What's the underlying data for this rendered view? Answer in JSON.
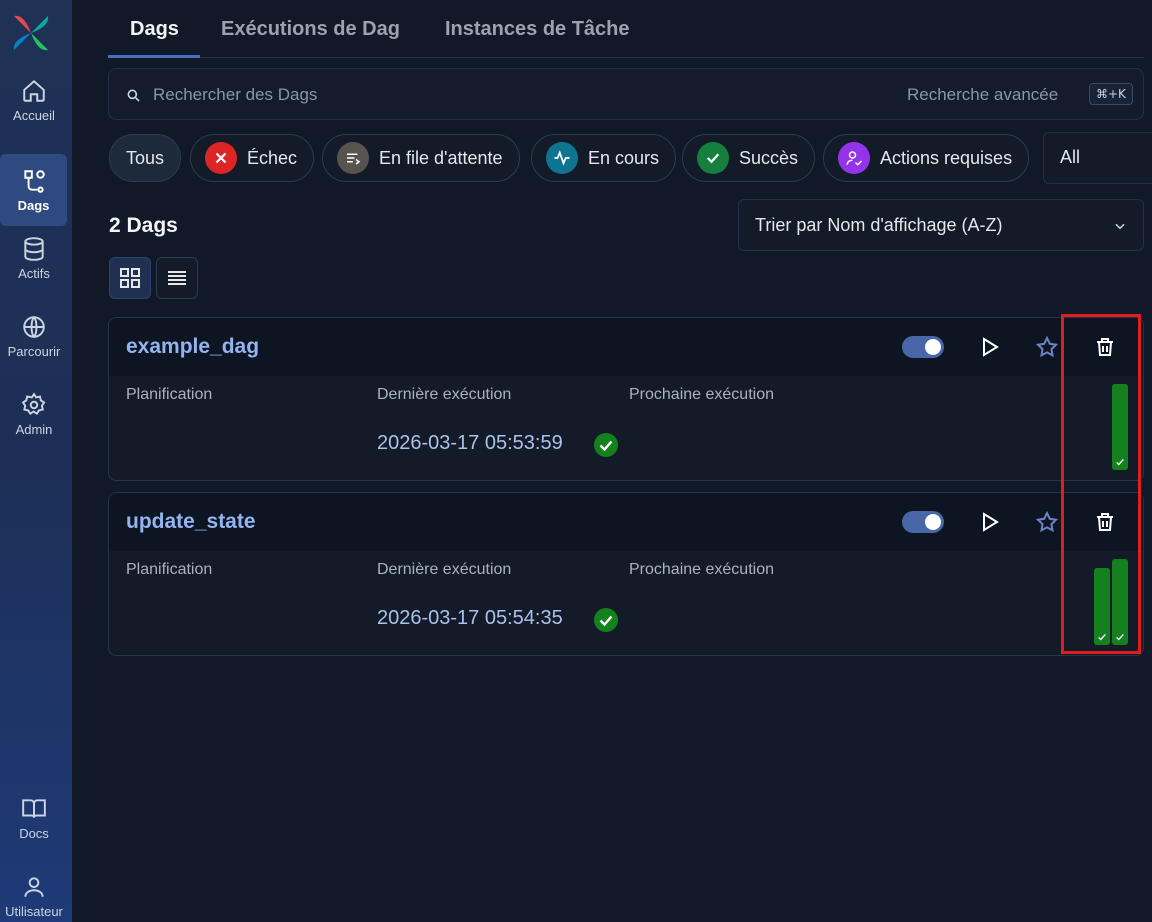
{
  "sidebar": {
    "items": [
      {
        "label": "Accueil",
        "icon": "home-icon"
      },
      {
        "label": "Dags",
        "icon": "dags-icon",
        "active": true
      },
      {
        "label": "Actifs",
        "icon": "database-icon"
      },
      {
        "label": "Parcourir",
        "icon": "globe-icon"
      },
      {
        "label": "Admin",
        "icon": "gear-icon"
      },
      {
        "label": "Docs",
        "icon": "book-icon"
      },
      {
        "label": "Utilisateur",
        "icon": "user-icon"
      }
    ]
  },
  "tabs": [
    {
      "label": "Dags",
      "active": true
    },
    {
      "label": "Exécutions de Dag"
    },
    {
      "label": "Instances de Tâche"
    }
  ],
  "search": {
    "placeholder": "Rechercher des Dags",
    "advanced_label": "Recherche avancée",
    "shortcut": "⌘+K"
  },
  "filters": [
    {
      "label": "Tous",
      "active": true
    },
    {
      "label": "Échec",
      "icon": "x-icon",
      "color": "#dc2626"
    },
    {
      "label": "En file d'attente",
      "icon": "queue-icon",
      "color": "#57534e"
    },
    {
      "label": "En cours",
      "icon": "activity-icon",
      "color": "#0e7490"
    },
    {
      "label": "Succès",
      "icon": "check-icon",
      "color": "#15803d"
    },
    {
      "label": "Actions requises",
      "icon": "user-action-icon",
      "color": "#9333ea"
    }
  ],
  "tag_select": {
    "value": "All"
  },
  "dag_count": "2 Dags",
  "sort": {
    "label": "Trier par Nom d'affichage (A-Z)"
  },
  "columns": {
    "schedule": "Planification",
    "last_run": "Dernière exécution",
    "next_run": "Prochaine exécution"
  },
  "dags": [
    {
      "name": "example_dag",
      "enabled": true,
      "last_run": "2026-03-17 05:53:59",
      "last_run_state": "success",
      "recent_runs": [
        {
          "state": "success",
          "duration_fraction": 1.0
        }
      ]
    },
    {
      "name": "update_state",
      "enabled": true,
      "last_run": "2026-03-17 05:54:35",
      "last_run_state": "success",
      "recent_runs": [
        {
          "state": "success",
          "duration_fraction": 0.89
        },
        {
          "state": "success",
          "duration_fraction": 1.0
        }
      ]
    }
  ],
  "colors": {
    "accent": "#4866a8",
    "success": "#15801e",
    "highlight": "#e11d1d"
  }
}
